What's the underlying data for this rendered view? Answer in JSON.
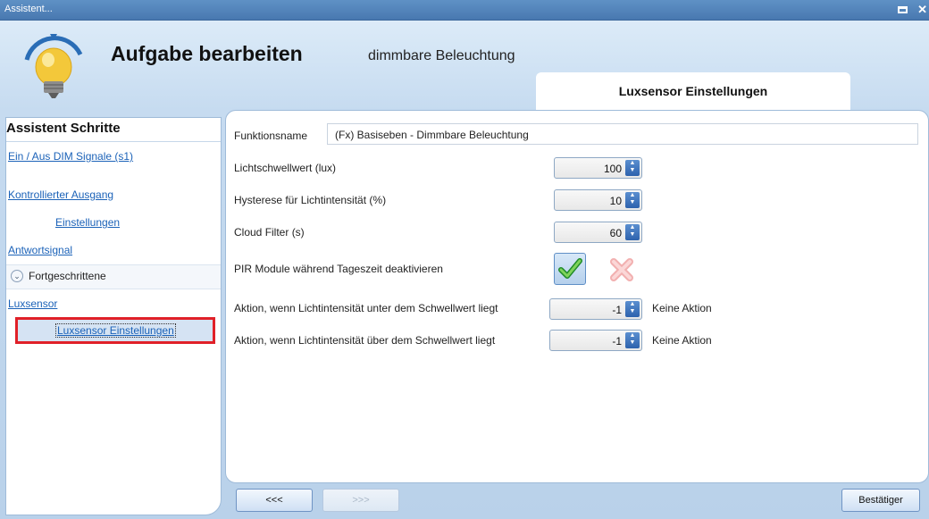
{
  "window": {
    "title": "Assistent..."
  },
  "header": {
    "title": "Aufgabe bearbeiten",
    "subtitle": "dimmbare Beleuchtung",
    "tab_label": "Luxsensor Einstellungen"
  },
  "sidebar": {
    "title": "Assistent Schritte",
    "items": [
      {
        "label": "Ein / Aus DIM Signale (s1)"
      },
      {
        "label": "Kontrollierter Ausgang"
      },
      {
        "label": "Einstellungen"
      },
      {
        "label": "Antwortsignal"
      },
      {
        "label": "Fortgeschrittene"
      },
      {
        "label": "Luxsensor"
      },
      {
        "label": "Luxsensor Einstellungen"
      }
    ]
  },
  "form": {
    "function_name_label": "Funktionsname",
    "function_name_value": "(Fx) Basiseben - Dimmbare Beleuchtung",
    "lux_threshold": {
      "label": "Lichtschwellwert (lux)",
      "value": "100"
    },
    "hysteresis": {
      "label": "Hysterese für Lichtintensität (%)",
      "value": "10"
    },
    "cloud_filter": {
      "label": "Cloud Filter (s)",
      "value": "60"
    },
    "pir_disable": {
      "label": "PIR Module während Tageszeit deaktivieren",
      "selected": "yes"
    },
    "action_below": {
      "label": "Aktion, wenn Lichtintensität unter dem Schwellwert liegt",
      "value": "-1",
      "text": "Keine Aktion"
    },
    "action_above": {
      "label": "Aktion, wenn Lichtintensität über dem Schwellwert liegt",
      "value": "-1",
      "text": "Keine Aktion"
    }
  },
  "footer": {
    "back_label": "<<<",
    "next_label": ">>>",
    "confirm_label": "Bestätiger"
  },
  "colors": {
    "accent": "#1b62b8",
    "selection_border": "#e02028",
    "titlebar": "#4f83bb"
  }
}
